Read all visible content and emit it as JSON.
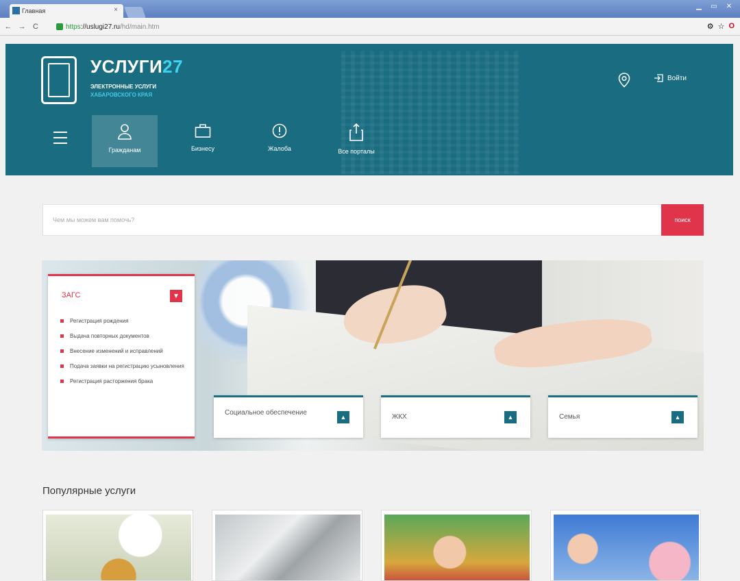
{
  "browser": {
    "tab_title": "Главная",
    "url_https": "https",
    "url_domain": "://uslugi27.ru",
    "url_path": "/hd/main.htm",
    "close_tab": "×"
  },
  "header": {
    "logo_title": "УСЛУГИ",
    "logo_number": "27",
    "logo_sub1": "ЭЛЕКТРОННЫЕ УСЛУГИ",
    "logo_sub2": "ХАБАРОВСКОГО КРАЯ",
    "login_label": "Войти",
    "categories": [
      {
        "label": "Гражданам",
        "icon": "person-icon"
      },
      {
        "label": "Бизнесу",
        "icon": "briefcase-icon"
      },
      {
        "label": "Жалоба",
        "icon": "alert-icon"
      },
      {
        "label": "Все порталы",
        "icon": "share-icon"
      }
    ]
  },
  "search": {
    "placeholder": "Чем мы можем вам помочь?",
    "button_label": "поиск"
  },
  "banner": {
    "zags": {
      "title": "ЗАГС",
      "items": [
        "Регистрация рождения",
        "Выдача повторных документов",
        "Внесение изменений и исправлений",
        "Подача заявки на регистрацию усыновления",
        "Регистрация расторжения брака"
      ]
    },
    "cards": [
      {
        "label": "Социальное обеспечение"
      },
      {
        "label": "ЖКХ"
      },
      {
        "label": "Семья"
      }
    ]
  },
  "popular": {
    "title": "Популярные услуги"
  },
  "colors": {
    "brand": "#1a6d80",
    "accent": "#e0344b",
    "logo_number": "#3fd3f0"
  }
}
